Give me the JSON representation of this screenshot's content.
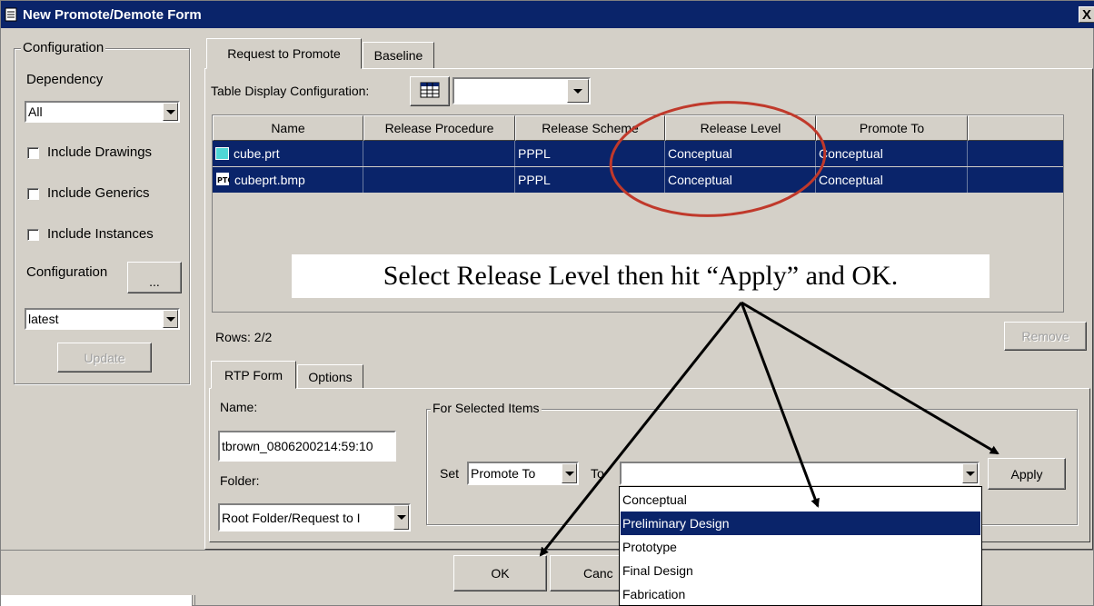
{
  "window": {
    "title": "New Promote/Demote Form",
    "close_glyph": "X"
  },
  "config_panel": {
    "group_title": "Configuration",
    "dependency_label": "Dependency",
    "dependency_value": "All",
    "checkboxes": [
      {
        "label": "Include Drawings",
        "checked": false
      },
      {
        "label": "Include Generics",
        "checked": false
      },
      {
        "label": "Include Instances",
        "checked": false
      }
    ],
    "configuration_label": "Configuration",
    "configuration_button": "...",
    "configuration_value": "latest",
    "update_button": "Update"
  },
  "main_tabs": [
    {
      "label": "Request to Promote",
      "active": true
    },
    {
      "label": "Baseline",
      "active": false
    }
  ],
  "table_display": {
    "label": "Table Display Configuration:",
    "icon": "table-icon",
    "value": ""
  },
  "table": {
    "columns": [
      "Name",
      "Release Procedure",
      "Release Scheme",
      "Release Level",
      "Promote To"
    ],
    "rows": [
      {
        "icon": "part-icon",
        "name": "cube.prt",
        "release_procedure": "",
        "release_scheme": "PPPL",
        "release_level": "Conceptual",
        "promote_to": "Conceptual"
      },
      {
        "icon": "ptc-image-icon",
        "name": "cubeprt.bmp",
        "release_procedure": "",
        "release_scheme": "PPPL",
        "release_level": "Conceptual",
        "promote_to": "Conceptual"
      }
    ],
    "selection_color": "#0a246a"
  },
  "rows_count": "Rows: 2/2",
  "remove_button": "Remove",
  "form_tabs": [
    {
      "label": "RTP Form",
      "active": true
    },
    {
      "label": "Options",
      "active": false
    }
  ],
  "form": {
    "name_label": "Name:",
    "name_value": "tbrown_0806200214:59:10",
    "folder_label": "Folder:",
    "folder_value": "Root Folder/Request to I"
  },
  "selected_items": {
    "group_title": "For Selected Items",
    "set_label": "Set",
    "set_value": "Promote To",
    "to_label": "To",
    "to_value": "",
    "apply_button": "Apply"
  },
  "dropdown_options": [
    {
      "label": "Conceptual",
      "selected": false
    },
    {
      "label": "Preliminary Design",
      "selected": true
    },
    {
      "label": "Prototype",
      "selected": false
    },
    {
      "label": "Final Design",
      "selected": false
    },
    {
      "label": "Fabrication",
      "selected": false
    }
  ],
  "footer": {
    "ok_button": "OK",
    "cancel_button": "Canc"
  },
  "annotation": {
    "text": "Select Release Level then hit “Apply” and OK.",
    "ellipse_color": "#c0392b",
    "arrow_color": "#000000"
  }
}
